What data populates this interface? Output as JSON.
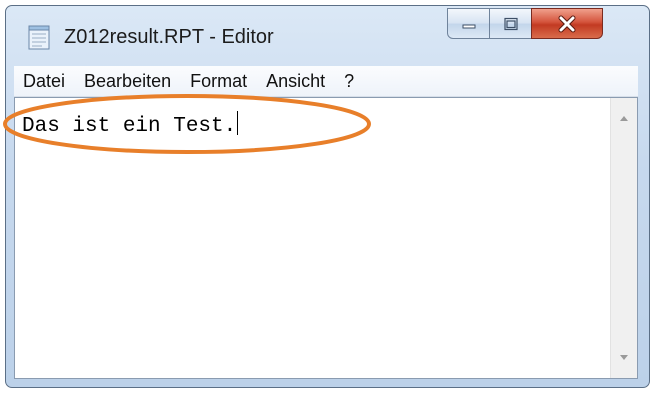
{
  "window": {
    "title": "Z012result.RPT - Editor",
    "icon": "notepad-icon"
  },
  "controls": {
    "minimize_icon": "minimize-icon",
    "maximize_icon": "maximize-icon",
    "close_icon": "close-icon"
  },
  "menu": {
    "items": [
      {
        "label": "Datei"
      },
      {
        "label": "Bearbeiten"
      },
      {
        "label": "Format"
      },
      {
        "label": "Ansicht"
      },
      {
        "label": "?"
      }
    ]
  },
  "editor": {
    "content": "Das ist ein Test."
  },
  "colors": {
    "annotation_ellipse": "#e87f2a",
    "close_button": "#c8462e"
  }
}
